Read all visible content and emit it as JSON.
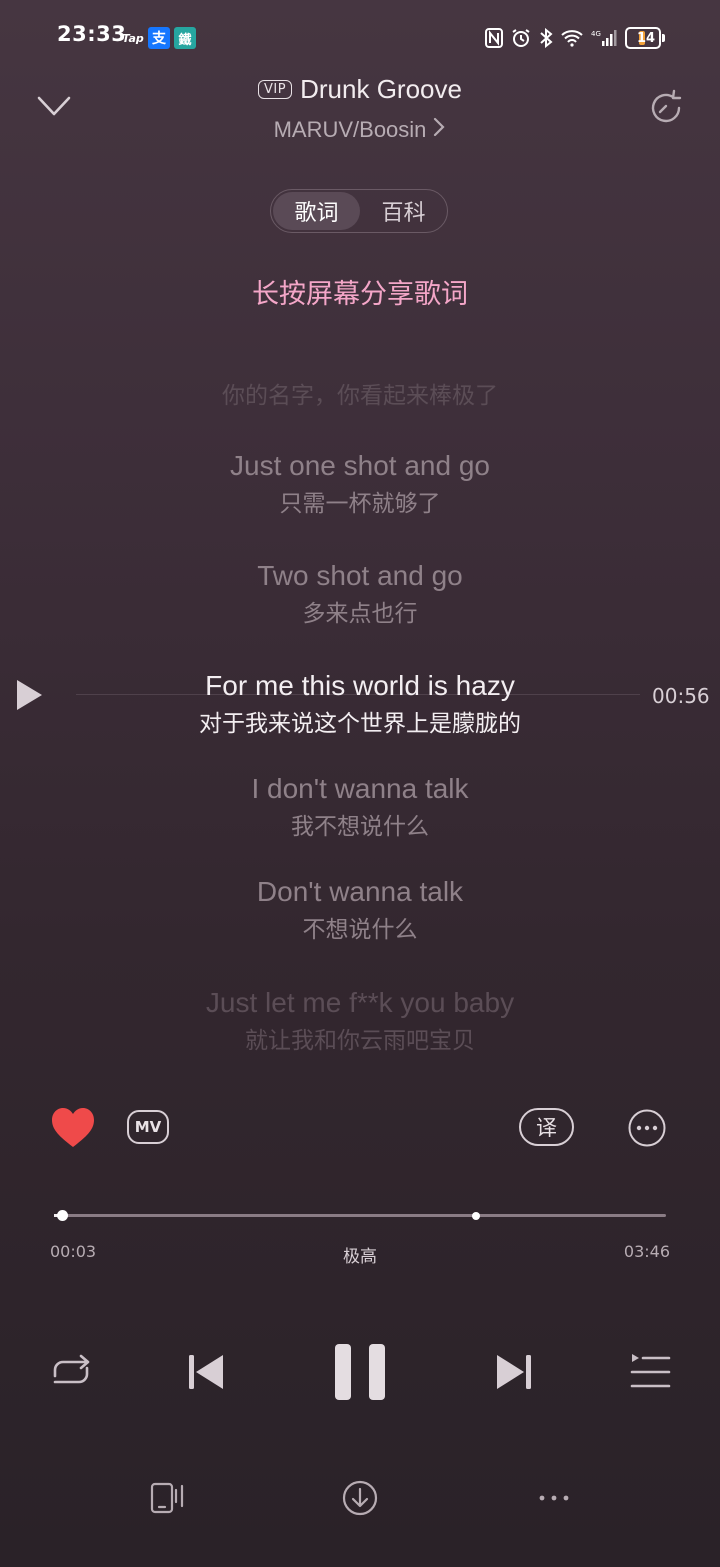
{
  "status_bar": {
    "time": "23:33",
    "app_icons": [
      "Tap",
      "支",
      "鐵"
    ],
    "battery_level": "14",
    "battery_color": "#f2a23a"
  },
  "header": {
    "vip_badge": "VIP",
    "song_title": "Drunk Groove",
    "artist": "MARUV/Boosin"
  },
  "tabs": [
    {
      "label": "歌词",
      "active": true
    },
    {
      "label": "百科",
      "active": false
    }
  ],
  "share_hint": "长按屏幕分享歌词",
  "lyrics": [
    {
      "en": "",
      "zh": "你的名字，你看起来棒极了",
      "state": "faint"
    },
    {
      "en": "Just one shot and go",
      "zh": "只需一杯就够了",
      "state": "dim"
    },
    {
      "en": "Two shot and go",
      "zh": "多来点也行",
      "state": "dim"
    },
    {
      "en": "For me this world is hazy",
      "zh": "对于我来说这个世界上是朦胧的",
      "state": "current"
    },
    {
      "en": "I don't wanna talk",
      "zh": "我不想说什么",
      "state": "dim"
    },
    {
      "en": "Don't wanna talk",
      "zh": "不想说什么",
      "state": "dim"
    },
    {
      "en": "Just let me f**k you baby",
      "zh": "就让我和你云雨吧宝贝",
      "state": "faint"
    }
  ],
  "line_time": "00:56",
  "actions": {
    "mv_label": "MV",
    "translate_label": "译",
    "liked": true,
    "like_color": "#ef4a4a"
  },
  "progress": {
    "elapsed": "00:03",
    "total": "03:46",
    "quality": "极高",
    "played_fraction": 0.013,
    "buffered_fraction": 0.69
  },
  "player": {
    "state": "playing"
  },
  "colors": {
    "accent_pink": "#f4a6c8",
    "background_top": "#463641",
    "background_bottom": "#2a2228"
  }
}
